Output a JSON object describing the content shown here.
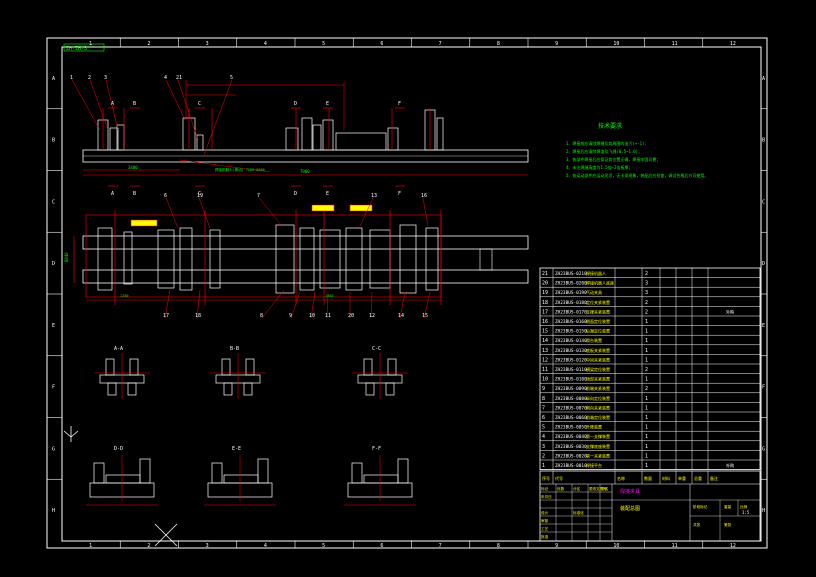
{
  "drawing": {
    "title_tag": "ZH-ZH-3",
    "tech_title": "技术要求",
    "tech_notes": [
      "1、焊接前应清除焊缝及其周围的油污(+-1)；",
      "2、焊接后应清除焊渣及飞溅(0.5~1.0)；",
      "3、各部件焊接后应保证其位置正确，焊接牢固可靠；",
      "4、未注焊缝高度为1.5倍~2倍板厚；",
      "5、各运动部件应运动灵活，无卡滞现象，装配后应检查，调试合格后方可使用。"
    ],
    "section_titles": [
      "A-A",
      "B-B",
      "C-C",
      "D-D",
      "E-E",
      "F-F"
    ],
    "top_balloons": [
      "1",
      "2",
      "3",
      "4",
      "21",
      "5"
    ],
    "plan_bottom_balloons": [
      "17",
      "18",
      "8",
      "9",
      "10",
      "11",
      "20",
      "12",
      "14",
      "15"
    ],
    "plan_top_balloons": [
      "6",
      "19",
      "7",
      "13",
      "16"
    ],
    "section_markers": [
      "A",
      "B",
      "C",
      "D",
      "E",
      "F"
    ]
  },
  "border": {
    "top_numbers": [
      "1",
      "2",
      "3",
      "4",
      "5",
      "6",
      "7",
      "8",
      "9",
      "10",
      "11",
      "12"
    ],
    "side_letters": [
      "A",
      "B",
      "C",
      "D",
      "E",
      "F",
      "G",
      "H"
    ]
  },
  "bom": {
    "rows": [
      {
        "no": "21",
        "code": "ZH23BUS-0210",
        "name": "焊接机器人",
        "qty": "2",
        "note": ""
      },
      {
        "no": "20",
        "code": "ZH23BUS-0200",
        "name": "焊接机器人底座",
        "qty": "3",
        "note": ""
      },
      {
        "no": "19",
        "code": "ZH23BUS-0190",
        "name": "气动夹具",
        "qty": "3",
        "note": ""
      },
      {
        "no": "18",
        "code": "ZH23BUS-0180",
        "name": "定位夹紧装置",
        "qty": "2",
        "note": ""
      },
      {
        "no": "17",
        "code": "ZH23BUS-0170",
        "name": "支撑夹紧装置",
        "qty": "2",
        "note": "外购"
      },
      {
        "no": "16",
        "code": "ZH23BUS-0160",
        "name": "侧面定位装置",
        "qty": "1",
        "note": ""
      },
      {
        "no": "15",
        "code": "ZH23BUS-0150",
        "name": "后端定位装置",
        "qty": "1",
        "note": ""
      },
      {
        "no": "14",
        "code": "ZH23BUS-0140",
        "name": "滑台装置",
        "qty": "1",
        "note": ""
      },
      {
        "no": "13",
        "code": "ZH23BUS-0130",
        "name": "底板夹紧装置",
        "qty": "1",
        "note": ""
      },
      {
        "no": "12",
        "code": "ZH23BUS-0120",
        "name": "中间夹紧装置",
        "qty": "1",
        "note": ""
      },
      {
        "no": "11",
        "code": "ZH23BUS-0110",
        "name": "横梁定位装置",
        "qty": "2",
        "note": ""
      },
      {
        "no": "10",
        "code": "ZH23BUS-0100",
        "name": "顶部夹紧装置",
        "qty": "1",
        "note": ""
      },
      {
        "no": "9",
        "code": "ZH23BUS-0090",
        "name": "前端夹紧装置",
        "qty": "2",
        "note": ""
      },
      {
        "no": "8",
        "code": "ZH23BUS-0080",
        "name": "纵向定位装置",
        "qty": "1",
        "note": ""
      },
      {
        "no": "7",
        "code": "ZH23BUS-0070",
        "name": "侧向夹紧装置",
        "qty": "1",
        "note": ""
      },
      {
        "no": "6",
        "code": "ZH23BUS-0060",
        "name": "前端定位装置",
        "qty": "1",
        "note": ""
      },
      {
        "no": "5",
        "code": "ZH23BUS-0050",
        "name": "升降装置",
        "qty": "1",
        "note": ""
      },
      {
        "no": "4",
        "code": "ZH23BUS-0040",
        "name": "第一支撑装置",
        "qty": "1",
        "note": ""
      },
      {
        "no": "3",
        "code": "ZH23BUS-0030",
        "name": "支撑底座装置",
        "qty": "1",
        "note": ""
      },
      {
        "no": "2",
        "code": "ZH23BUS-0020",
        "name": "第一夹紧装置",
        "qty": "1",
        "note": ""
      },
      {
        "no": "1",
        "code": "ZH23BUS-0010",
        "name": "焊接平台",
        "qty": "1",
        "note": "外购"
      }
    ],
    "header": [
      "序号",
      "代号",
      "名称",
      "数量",
      "材料",
      "单重",
      "总重",
      "备注"
    ]
  },
  "title_block": {
    "main_title": "焊接夹具",
    "sub_title": "装配总图",
    "labels": [
      "标记",
      "处数",
      "分区",
      "更改文件号",
      "签名",
      "年月日",
      "设计",
      "审核",
      "工艺",
      "批准",
      "标准化",
      "阶段标记",
      "重量",
      "比例",
      "共张",
      "第张"
    ],
    "scale": "1:5"
  }
}
